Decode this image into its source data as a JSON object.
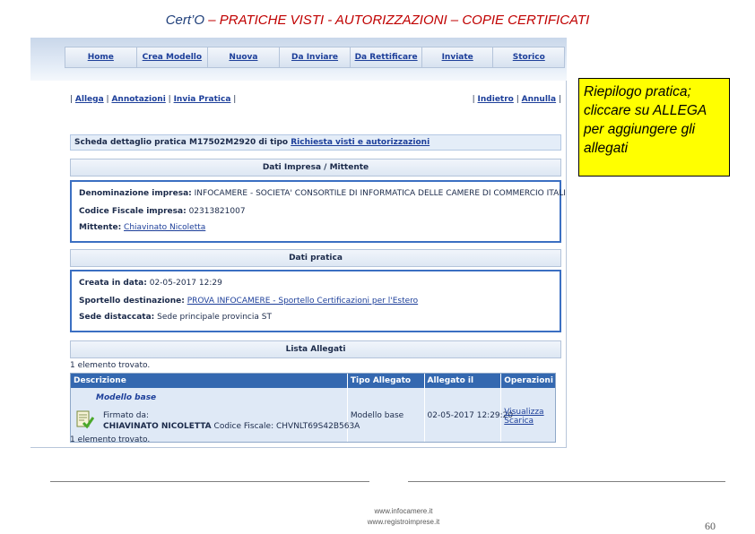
{
  "slide": {
    "title_prefix": "Cert’O",
    "title_rest": " – PRATICHE VISTI  - AUTORIZZAZIONI – COPIE CERTIFICATI",
    "page_number": "60",
    "footer_links": [
      "www.infocamere.it",
      "www.registroimprese.it"
    ]
  },
  "navbar": {
    "tabs": [
      "Home",
      "Crea Modello",
      "Nuova",
      "Da Inviare",
      "Da Rettificare",
      "Inviate",
      "Storico"
    ]
  },
  "actions": {
    "left": [
      "Allega",
      "Annotazioni",
      "Invia Pratica"
    ],
    "right": [
      "Indietro",
      "Annulla"
    ]
  },
  "detail": {
    "prefix": "Scheda dettaglio pratica M17502M2920 di tipo ",
    "type_link": "Richiesta visti e autorizzazioni"
  },
  "impresa": {
    "section_title": "Dati Impresa / Mittente",
    "denominazione_label": "Denominazione impresa:",
    "denominazione_value": "INFOCAMERE - SOCIETA' CONSORTILE DI INFORMATICA DELLE CAMERE DI COMMERCIO ITALI",
    "cf_label": "Codice Fiscale impresa:",
    "cf_value": "02313821007",
    "mittente_label": "Mittente:",
    "mittente_value": "Chiavinato Nicoletta"
  },
  "pratica": {
    "section_title": "Dati pratica",
    "creata_label": "Creata in data:",
    "creata_value": "02-05-2017 12:29",
    "sportello_label": "Sportello destinazione:",
    "sportello_value": "PROVA INFOCAMERE - Sportello Certificazioni per l'Estero",
    "sede_label": "Sede distaccata:",
    "sede_value": "Sede principale provincia ST"
  },
  "allegati": {
    "section_title": "Lista Allegati",
    "count_text": "1 elemento trovato.",
    "columns": [
      "Descrizione",
      "Tipo Allegato",
      "Allegato il",
      "Operazioni"
    ],
    "rows": [
      {
        "model": "Modello base",
        "signed_label": "Firmato da:",
        "signer_name": "CHIAVINATO NICOLETTA",
        "signer_cf": "Codice Fiscale: CHVNLT69S42B563A",
        "tipo": "Modello base",
        "data": "02-05-2017 12:29:20",
        "operation": "Visualizza Scarica"
      }
    ]
  },
  "callout": {
    "text": "Riepilogo pratica; cliccare su ALLEGA per aggiungere gli allegati"
  },
  "colors": {
    "accent_blue": "#3b6fc2",
    "link_blue": "#1d3f9a",
    "callout_yellow": "#ffff00",
    "title_red": "#c00000"
  }
}
